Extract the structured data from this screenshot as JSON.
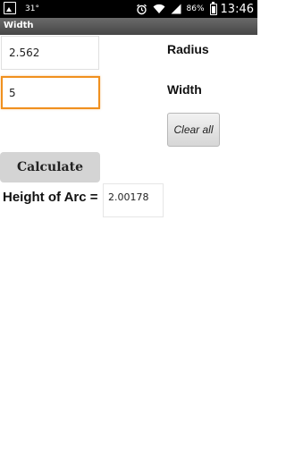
{
  "status_bar": {
    "temperature": "31°",
    "battery_percent": "86%",
    "battery_level": 0.86,
    "time": "13:46",
    "icons": [
      "image-notification-icon",
      "alarm-icon",
      "wifi-icon",
      "signal-icon",
      "battery-icon"
    ]
  },
  "app": {
    "title": "Width"
  },
  "form": {
    "radius_value": "2.562",
    "radius_label": "Radius",
    "width_value": "5",
    "width_label": "Width",
    "clear_label": "Clear all",
    "calculate_label": "Calculate",
    "height_label": "Height of Arc =",
    "height_result": "2.00178"
  },
  "colors": {
    "focus_border": "#f0901e",
    "title_bar": "#555555",
    "status_bar": "#000000"
  }
}
